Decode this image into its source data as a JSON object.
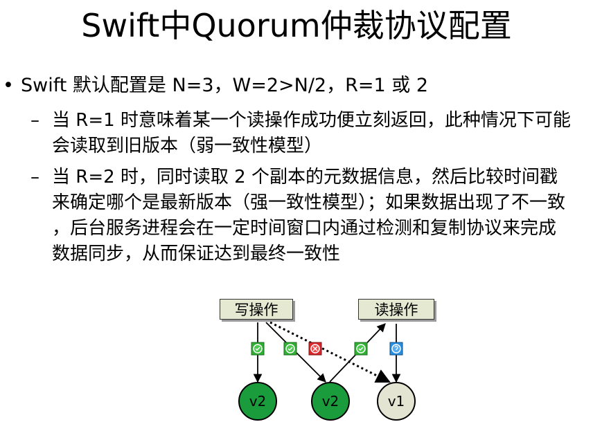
{
  "slide": {
    "title": "Swift中Quorum仲裁协议配置",
    "bullet": {
      "marker": "•",
      "text": "Swift 默认配置是 N=3，W=2>N/2，R=1 或 2"
    },
    "sub_items": [
      {
        "marker": "–",
        "text": "当 R=1 时意味着某一个读操作成功便立刻返回，此种情况下可能会读取到旧版本（弱一致性模型）"
      },
      {
        "marker": "–",
        "text": "当 R=2 时，同时读取 2 个副本的元数据信息，然后比较时间戳来确定哪个是最新版本（强一致性模型）；如果数据出现了不一致，后台服务进程会在一定时间窗口内通过检测和复制协议来完成数据同步，从而保证达到最终一致性"
      }
    ]
  },
  "diagram": {
    "write_label": "写操作",
    "read_label": "读操作",
    "nodes": [
      {
        "label": "v2",
        "color": "#1a9c3c"
      },
      {
        "label": "v2",
        "color": "#1a9c3c"
      },
      {
        "label": "v1",
        "color": "#e4e4d2"
      }
    ],
    "status_colors": {
      "ok": "#2fae33",
      "fail": "#d8262a",
      "query": "#2a8fe0"
    }
  }
}
